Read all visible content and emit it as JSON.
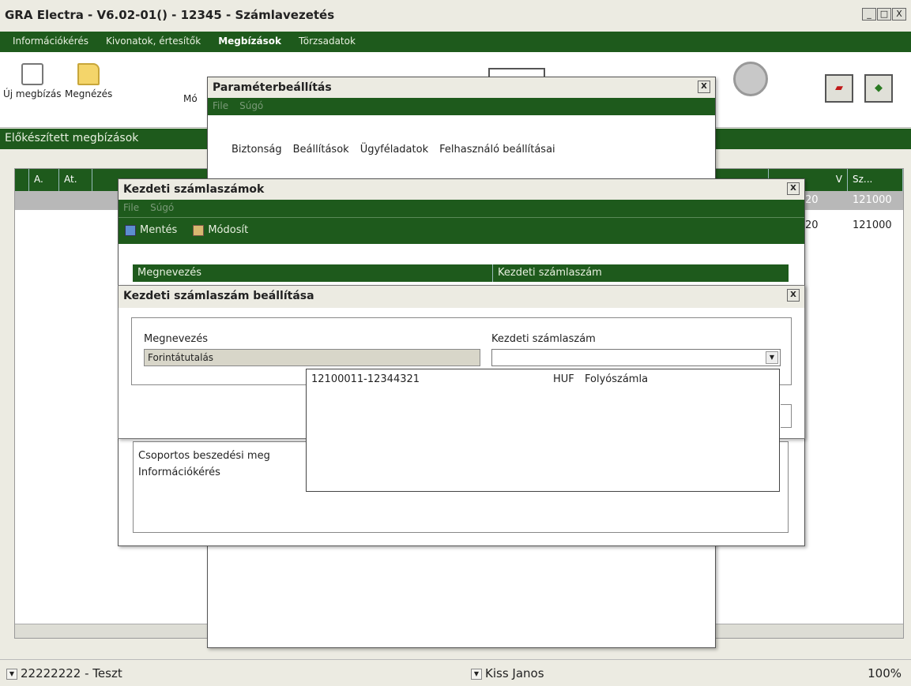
{
  "window": {
    "title": "GRA Electra - V6.02-01() - 12345 - Számlavezetés",
    "btn_min": "_",
    "btn_max": "□",
    "btn_close": "X"
  },
  "menu": [
    {
      "label": "Információkérés"
    },
    {
      "label": "Kivonatok, értesítők"
    },
    {
      "label": "Megbízások"
    },
    {
      "label": "Törzsadatok"
    }
  ],
  "toolbar": {
    "new_label": "Új megbízás",
    "open_label": "Megnézés",
    "mod_label": "Mó"
  },
  "section": {
    "title": "Előkészített megbízások"
  },
  "columns": {
    "a": "A.",
    "at": "At.",
    "v": "V",
    "sz": "Sz..."
  },
  "rows": [
    {
      "c1": "20",
      "c2": "121000"
    },
    {
      "c1": "20",
      "c2": "121000"
    }
  ],
  "param_dialog": {
    "title": "Paraméterbeállítás",
    "menu_file": "File",
    "menu_help": "Súgó",
    "tabs": [
      "Biztonság",
      "Beállítások",
      "Ügyféladatok",
      "Felhasználó beállításai"
    ]
  },
  "kezdeti_dialog": {
    "title": "Kezdeti számlaszámok",
    "menu_file": "File",
    "menu_help": "Súgó",
    "save_label": "Mentés",
    "modify_label": "Módosít",
    "col_name": "Megnevezés",
    "col_account": "Kezdeti számlaszám",
    "rows": [
      "Csoportos beszedési meg",
      "Információkérés"
    ]
  },
  "set_dialog": {
    "title": "Kezdeti számlaszám beállítása",
    "name_label": "Megnevezés",
    "name_value": "Forintátutalás",
    "account_label": "Kezdeti számlaszám",
    "account_value": ""
  },
  "dropdown": {
    "account": "12100011-12344321",
    "currency": "HUF",
    "type": "Folyószámla"
  },
  "status": {
    "client": "22222222 - Teszt",
    "user": "Kiss Janos",
    "zoom": "100%"
  },
  "colors": {
    "accent": "#1e5a1c",
    "background": "#ecebe2"
  }
}
